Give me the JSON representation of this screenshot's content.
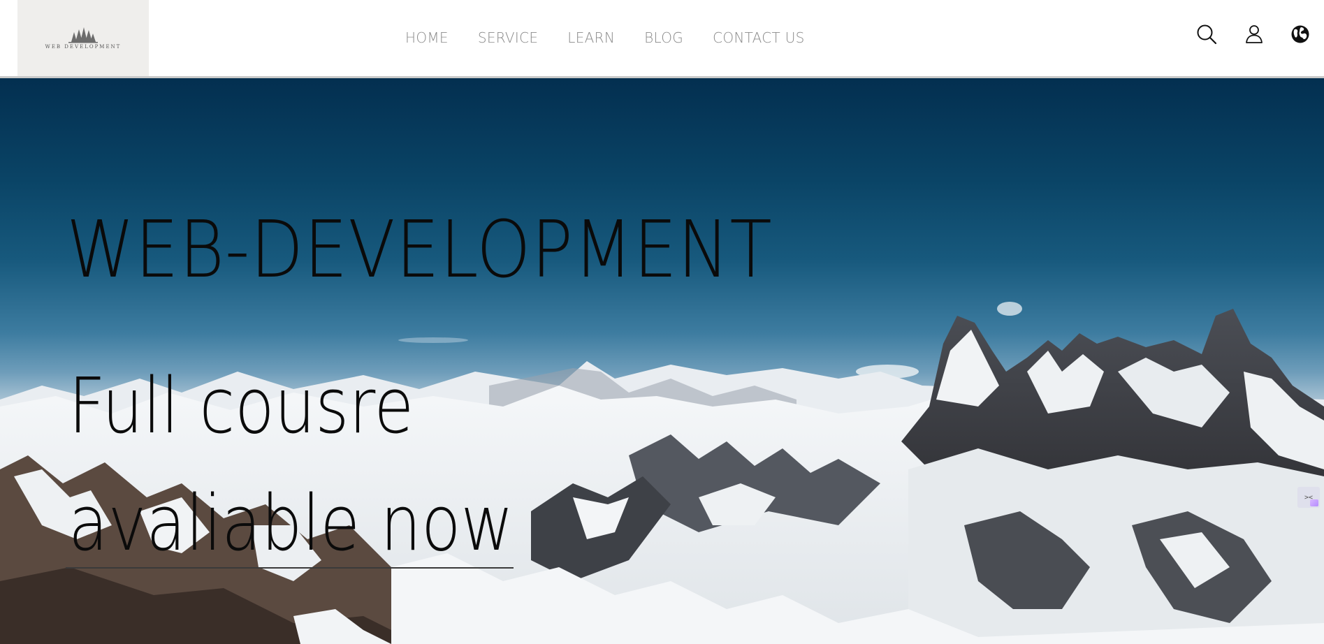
{
  "header": {
    "logo_text": "WEB DEVELOPMENT",
    "nav": [
      {
        "label": "HOME"
      },
      {
        "label": "SERVICE"
      },
      {
        "label": "LEARN"
      },
      {
        "label": "BLOG"
      },
      {
        "label": "CONTACT US"
      }
    ],
    "icons": [
      "search-icon",
      "user-icon",
      "globe-icon"
    ]
  },
  "hero": {
    "title": "WEB-DEVELOPMENT",
    "subtitle_line1": "Full cousre",
    "subtitle_line2": "avaliable now",
    "background": "snowy-mountain-range"
  },
  "colors": {
    "sky_top": "#032f50",
    "nav_text": "#8a8a8a",
    "logo_bg": "#efeeec"
  }
}
